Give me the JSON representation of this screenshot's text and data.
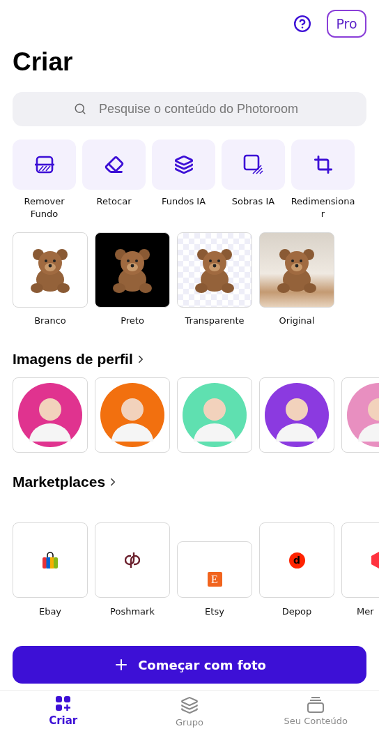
{
  "header": {
    "pro_label": "Pro"
  },
  "title": "Criar",
  "search": {
    "placeholder": "Pesquise o conteúdo do Photoroom"
  },
  "tools": [
    {
      "kind": "remove",
      "label": "Remover Fundo"
    },
    {
      "kind": "retouch",
      "label": "Retocar"
    },
    {
      "kind": "layers",
      "label": "Fundos IA"
    },
    {
      "kind": "shadow",
      "label": "Sobras IA"
    },
    {
      "kind": "crop",
      "label": "Redimensiona r"
    }
  ],
  "backgrounds": [
    {
      "kind": "white",
      "label": "Branco"
    },
    {
      "kind": "black",
      "label": "Preto"
    },
    {
      "kind": "transparent",
      "label": "Transparente"
    },
    {
      "kind": "original",
      "label": "Original"
    }
  ],
  "profile_section": {
    "title": "Imagens de perfil",
    "profiles": [
      {
        "color": "#e0338f"
      },
      {
        "color": "#f2700f"
      },
      {
        "color": "#5fe0b0"
      },
      {
        "color": "#8b3ae0"
      },
      {
        "color": "#e88fc0"
      }
    ]
  },
  "marketplace_section": {
    "title": "Marketplaces",
    "items": [
      {
        "kind": "ebay",
        "label": "Ebay"
      },
      {
        "kind": "poshmark",
        "label": "Poshmark"
      },
      {
        "kind": "etsy",
        "label": "Etsy",
        "logo_text": "E"
      },
      {
        "kind": "depop",
        "label": "Depop",
        "logo_text": "d"
      },
      {
        "kind": "mercari",
        "label": "Mer"
      }
    ]
  },
  "primary_button": {
    "label": "Começar com foto"
  },
  "nav": [
    {
      "kind": "create",
      "label": "Criar",
      "selected": true
    },
    {
      "kind": "batch",
      "label": "Grupo",
      "selected": false
    },
    {
      "kind": "content",
      "label": "Seu Conteúdo",
      "selected": false
    }
  ]
}
